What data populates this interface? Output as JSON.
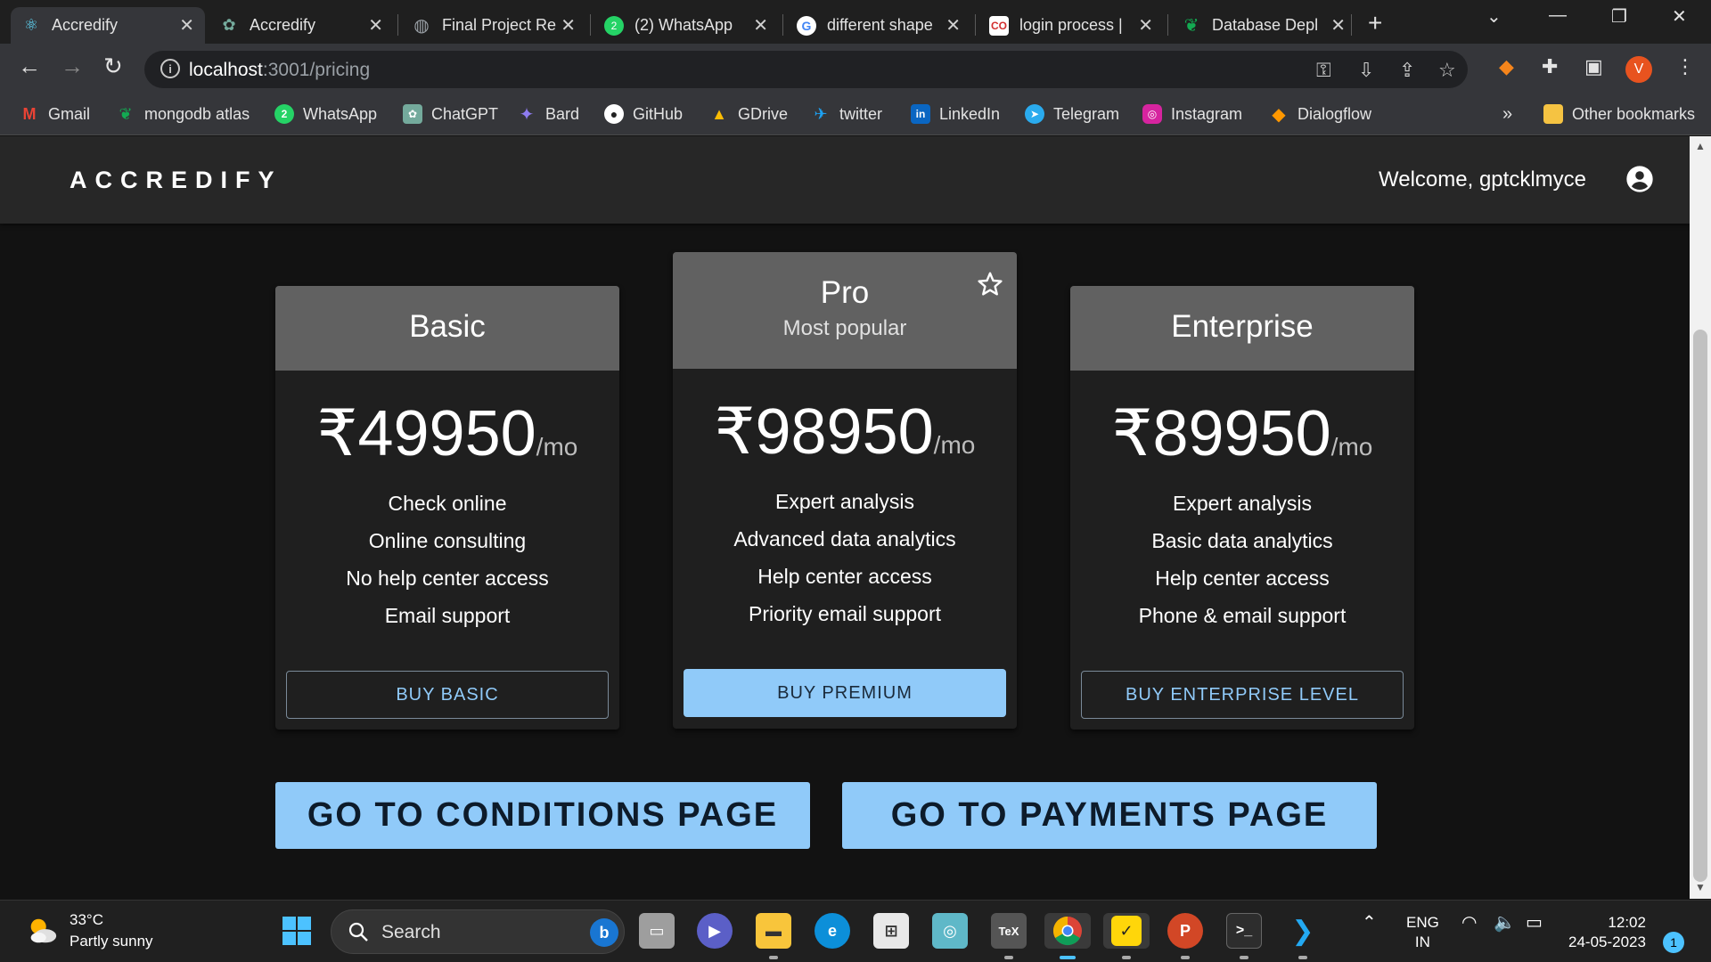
{
  "tabs": [
    {
      "title": "Accredify",
      "favicon": "react-icon",
      "color": "#61dafb"
    },
    {
      "title": "Accredify",
      "favicon": "chatgpt-icon",
      "color": "#74aa9c"
    },
    {
      "title": "Final Project Re",
      "favicon": "globe-icon",
      "color": "#9aa0a6"
    },
    {
      "title": "(2) WhatsApp",
      "favicon": "whatsapp-icon",
      "color": "#25d366"
    },
    {
      "title": "different shape",
      "favicon": "google-icon",
      "color": "#ffffff"
    },
    {
      "title": "login process |",
      "favicon": "codeforces-icon",
      "color": "#ffffff"
    },
    {
      "title": "Database Depl",
      "favicon": "mongodb-icon",
      "color": "#13aa52"
    }
  ],
  "address": {
    "host": "localhost",
    "path": ":3001/pricing"
  },
  "bookmarks": [
    {
      "label": "Gmail",
      "color": "#ea4335",
      "glyph": "M"
    },
    {
      "label": "mongodb atlas",
      "color": "#13aa52",
      "glyph": "●"
    },
    {
      "label": "WhatsApp",
      "color": "#25d366",
      "glyph": "2"
    },
    {
      "label": "ChatGPT",
      "color": "#74aa9c",
      "glyph": "✿"
    },
    {
      "label": "Bard",
      "color": "#8e7cf0",
      "glyph": "✦"
    },
    {
      "label": "GitHub",
      "color": "#444444",
      "glyph": "●"
    },
    {
      "label": "GDrive",
      "color": "#fbbc04",
      "glyph": "▲"
    },
    {
      "label": "twitter",
      "color": "#1da1f2",
      "glyph": "t"
    },
    {
      "label": "LinkedIn",
      "color": "#0a66c2",
      "glyph": "in"
    },
    {
      "label": "Telegram",
      "color": "#2aabee",
      "glyph": "➤"
    },
    {
      "label": "Instagram",
      "color": "#d6249f",
      "glyph": "◎"
    },
    {
      "label": "Dialogflow",
      "color": "#ff9800",
      "glyph": "◆"
    }
  ],
  "bookmarks_overflow": "»",
  "other_bookmarks": "Other bookmarks",
  "profile_initial": "V",
  "app": {
    "brand": "ACCREDIFY",
    "welcome": "Welcome, gptcklmyce"
  },
  "plans": [
    {
      "title": "Basic",
      "subtitle": "",
      "price": "₹49950",
      "per": "/mo",
      "features": [
        "Check online",
        "Online consulting",
        "No help center access",
        "Email support"
      ],
      "button": "BUY BASIC",
      "variant": "outline"
    },
    {
      "title": "Pro",
      "subtitle": "Most popular",
      "price": "₹98950",
      "per": "/mo",
      "features": [
        "Expert analysis",
        "Advanced data analytics",
        "Help center access",
        "Priority email support"
      ],
      "button": "BUY PREMIUM",
      "variant": "filled"
    },
    {
      "title": "Enterprise",
      "subtitle": "",
      "price": "₹89950",
      "per": "/mo",
      "features": [
        "Expert analysis",
        "Basic data analytics",
        "Help center access",
        "Phone & email support"
      ],
      "button": "BUY ENTERPRISE LEVEL",
      "variant": "outline"
    }
  ],
  "actions": {
    "conditions": "GO TO CONDITIONS PAGE",
    "payments": "GO TO PAYMENTS PAGE"
  },
  "taskbar": {
    "weather_temp": "33°C",
    "weather_desc": "Partly sunny",
    "search_label": "Search",
    "lang_top": "ENG",
    "lang_bottom": "IN",
    "time": "12:02",
    "date": "24-05-2023",
    "notifications": "1"
  },
  "colors": {
    "accent": "#90caf9",
    "card_header": "#616161",
    "appbar": "#272727"
  }
}
